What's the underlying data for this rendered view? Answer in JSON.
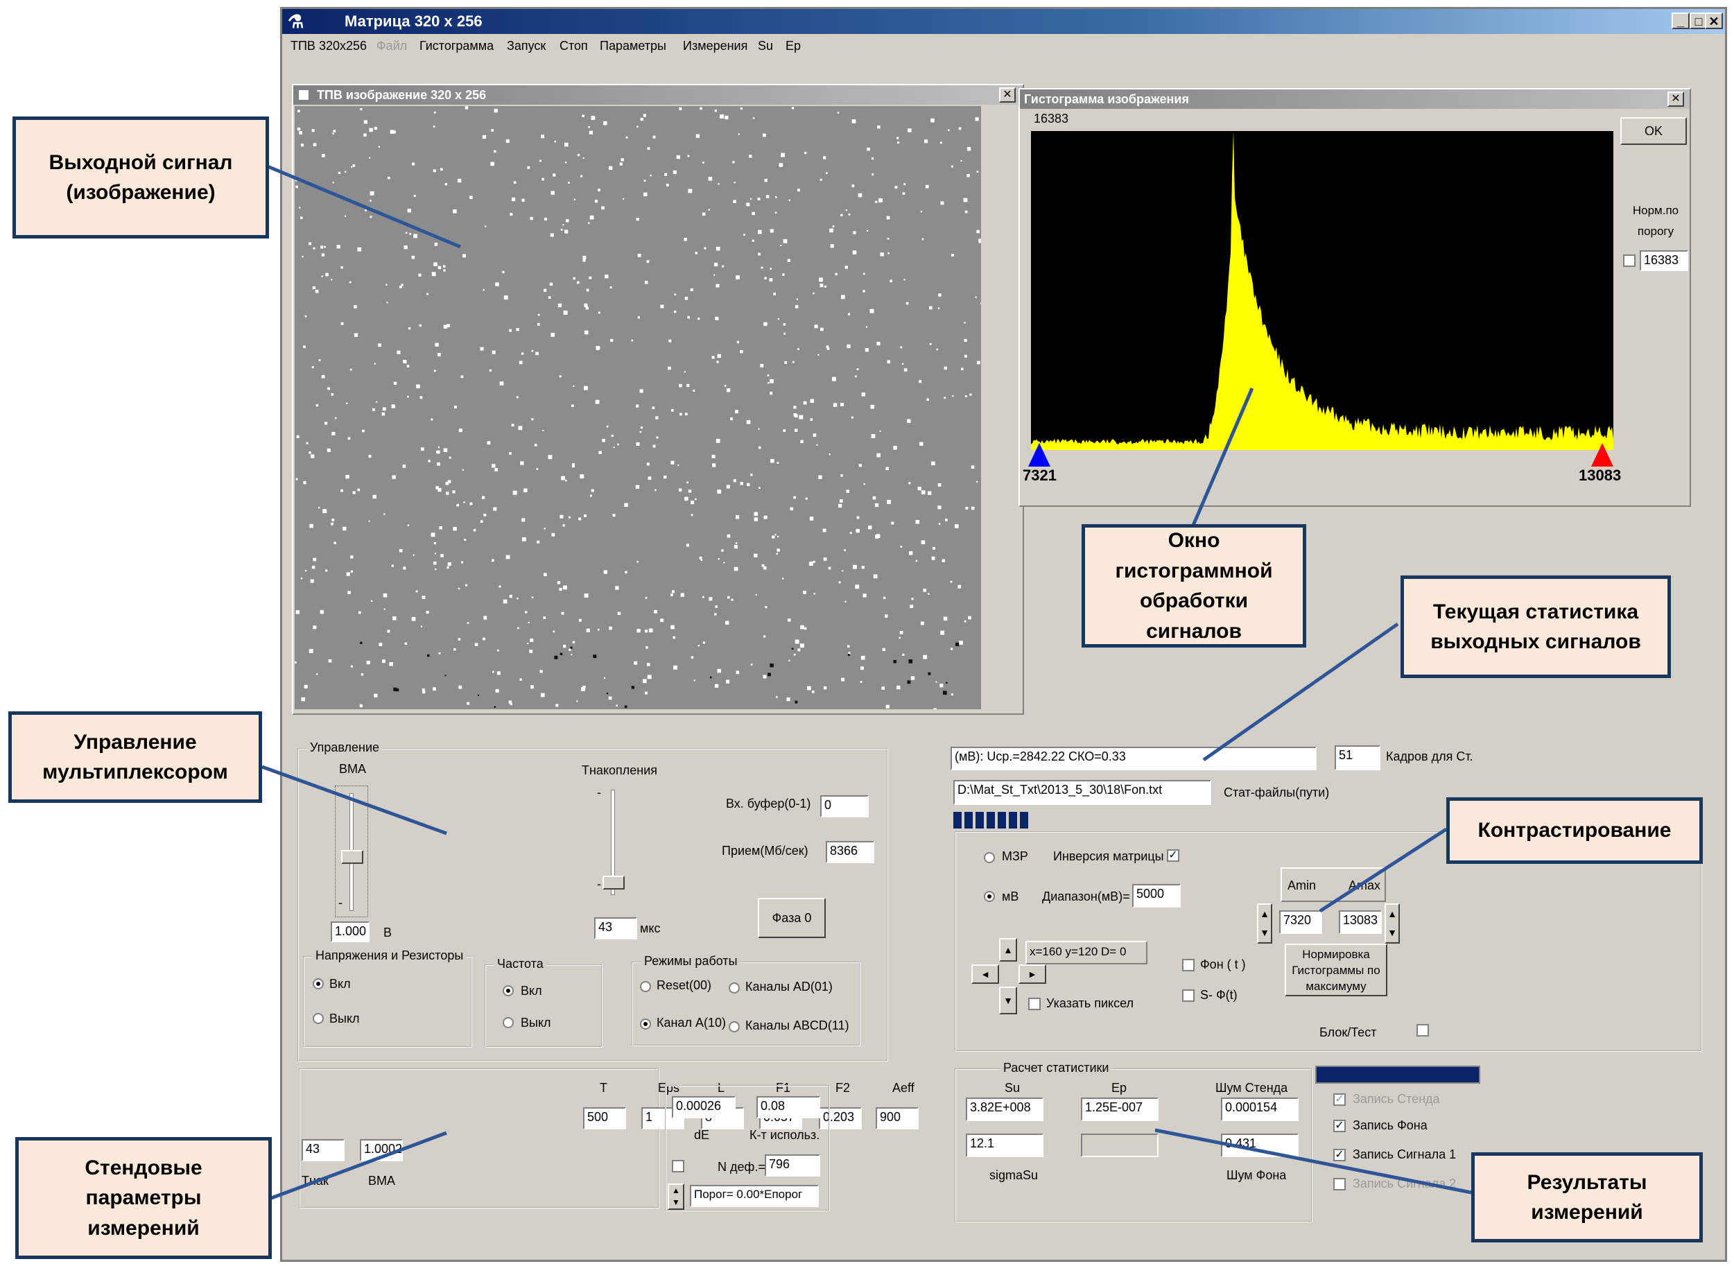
{
  "app": {
    "title": "Матрица 320 х 256",
    "menu": [
      "ТПВ 320х256",
      "Файл",
      "Гистограмма",
      "Запуск",
      "Стоп",
      "Параметры",
      "Измерения",
      "Su",
      "Ep"
    ],
    "menu_disabled": [
      1
    ]
  },
  "image_window": {
    "title": "ТПВ изображение 320 х 256"
  },
  "histogram": {
    "title": "Гистограмма изображения",
    "top_value": "16383",
    "ok_label": "OK",
    "norm_label": "Норм.по порогу",
    "norm_value": "16383",
    "left_marker": "7321",
    "right_marker": "13083",
    "fill_color": "#ffff00"
  },
  "control": {
    "group_label": "Управление",
    "vma_label": "ВМА",
    "vma_value": "1.000",
    "vma_unit": "В",
    "tnak_label": "Tнакопления",
    "tnak_value": "43",
    "tnak_unit": "мкс",
    "slider_minus": "-",
    "vx_buf_label": "Вх. буфер(0-1)",
    "vx_buf_value": "0",
    "priem_label": "Прием(Мб/сек)",
    "priem_value": "8366",
    "phase_button": "Фаза 0",
    "voltages_group": "Напряжения и Резисторы",
    "voltages_on": "Вкл",
    "voltages_off": "Выкл",
    "freq_group": "Частота",
    "freq_on": "Вкл",
    "freq_off": "Выкл",
    "modes_group": "Режимы работы",
    "modes": [
      "Reset(00)",
      "Каналы AD(01)",
      "Канал A(10)",
      "Каналы ABCD(11)"
    ]
  },
  "stand": {
    "headers": [
      "T",
      "Eps",
      "L",
      "F1",
      "F2",
      "Aeff"
    ],
    "values": [
      "500",
      "1",
      "8",
      "0.057",
      "0.203",
      "900"
    ],
    "row2_values": [
      "43",
      "1.0002"
    ],
    "row2_labels": [
      "Tнак",
      "ВМА"
    ],
    "de_value": "0.00026",
    "de_label": "dE",
    "kt_value": "0.08",
    "kt_label": "К-т использ.",
    "ndef_label": "N деф.=",
    "ndef_value": "796",
    "porog": "Порог= 0.00*Епорог"
  },
  "stats": {
    "current": "(мВ): Ucp.=2842.22  СКО=0.33",
    "frames_value": "51",
    "frames_label": "Кадров для Ст.",
    "path_value": "D:\\Mat_St_Txt\\2013_5_30\\18\\Fon.txt",
    "path_label": "Стат-файлы(пути)"
  },
  "contrast": {
    "mzr": "МЗР",
    "inversion": "Инверсия матрицы",
    "mv": "мВ",
    "range_label": "Диапазон(мВ)=",
    "range_value": "5000",
    "amin_label": "Amin",
    "amax_label": "Amax",
    "amin_value": "7320",
    "amax_value": "13083",
    "pixel_coords": "x=160 y=120 D= 0",
    "fon_label": "Фон ( t )",
    "sf_label": "S- Ф(t)",
    "point_pixel": "Указать пиксел",
    "norm_button": "Нормировка Гистограммы по максимуму",
    "blok_test": "Блок/Тест"
  },
  "calc": {
    "group_label": "Расчет статистики",
    "su_label": "Su",
    "ep_label": "Ep",
    "noise_stand_label": "Шум Стенда",
    "su_value": "3.82E+008",
    "ep_value": "1.25E-007",
    "noise_stand_value": "0.000154",
    "sigma_value": "12.1",
    "noise_fon_value": "0.431",
    "sigma_label": "sigmaSu",
    "noise_fon_label": "Шум Фона",
    "records": [
      "Запись Стенда",
      "Запись Фона",
      "Запись Сигнала 1",
      "Запись Сигнала 2"
    ]
  },
  "callouts": {
    "output_signal": "Выходной сигнал\n(изображение)",
    "hist_window": "Окно\nгистограммной\nобработки\nсигналов",
    "current_stats": "Текущая статистика\nвыходных сигналов",
    "mux_control": "Управление\nмультиплексором",
    "contrast": "Контрастирование",
    "stand_params": "Стендовые\nпараметры\nизмерений",
    "results": "Результаты\nизмерений"
  }
}
